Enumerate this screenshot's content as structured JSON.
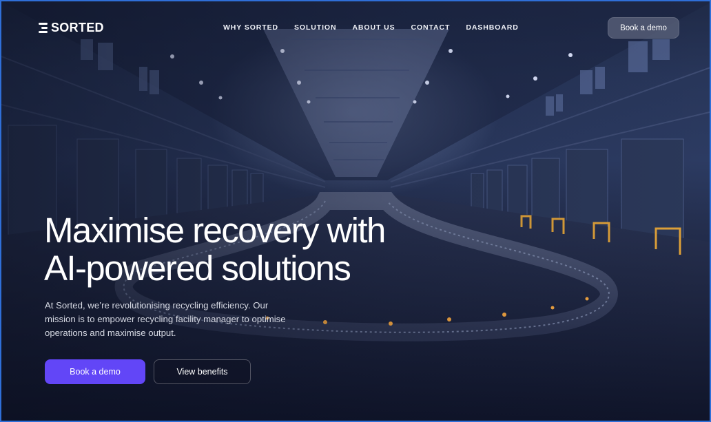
{
  "brand": {
    "name": "SORTED"
  },
  "nav": {
    "items": [
      {
        "label": "WHY SORTED"
      },
      {
        "label": "SOLUTION"
      },
      {
        "label": "ABOUT US"
      },
      {
        "label": "CONTACT"
      },
      {
        "label": "DASHBOARD"
      }
    ],
    "cta_label": "Book a demo"
  },
  "hero": {
    "headline_line1": "Maximise recovery with",
    "headline_line2": "AI-powered solutions",
    "subtext": "At Sorted, we’re revolutionising recycling efficiency. Our mission is to empower recycling facility manager to optimise operations and maximise output.",
    "primary_cta": "Book a demo",
    "secondary_cta": "View benefits",
    "background_icon": "warehouse-conveyor-image"
  },
  "colors": {
    "accent": "#6246f7",
    "background": "#0d1224"
  }
}
